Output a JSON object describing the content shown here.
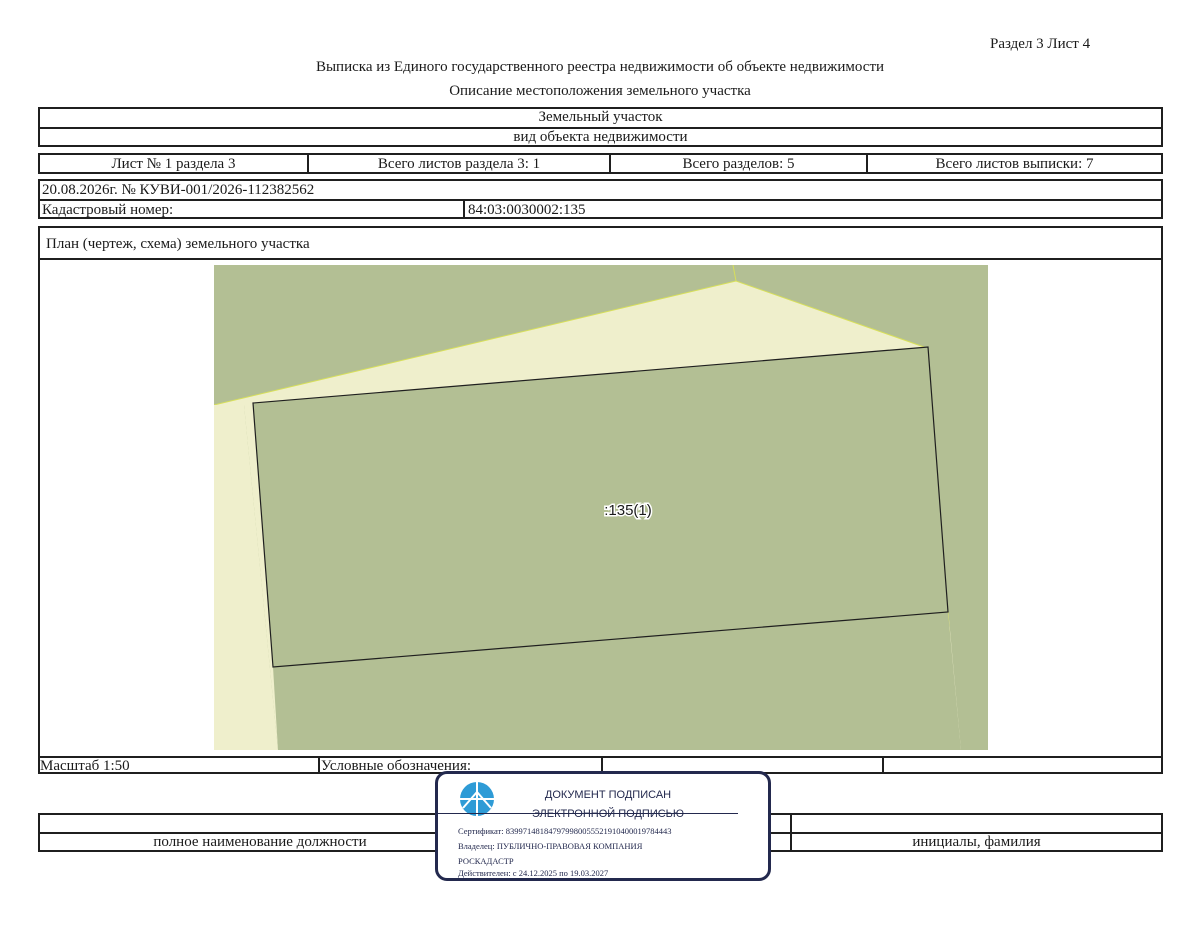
{
  "header": {
    "section_sheet": "Раздел 3    Лист 4",
    "title": "Выписка из Единого государственного реестра недвижимости об объекте недвижимости",
    "subtitle": "Описание местоположения земельного участка"
  },
  "object": {
    "name": "Земельный участок",
    "kind_label": "вид объекта недвижимости"
  },
  "sheets_row": {
    "sheet": "Лист № 1 раздела 3",
    "total_section_sheets": "Всего листов раздела 3: 1",
    "total_sections": "Всего разделов: 5",
    "total_extract_sheets": "Всего листов выписки: 7"
  },
  "request": {
    "date_number": "20.08.2026г. № КУВИ-001/2026-112382562",
    "cadastral_label": "Кадастровый номер:",
    "cadastral_value": "84:03:0030002:135"
  },
  "plan": {
    "title": "План (чертеж, схема) земельного участка",
    "parcel_label": ":135(1)",
    "colors": {
      "background": "#b3bf94",
      "road": "#efefcc",
      "outline": "#1f1f1f",
      "road_edge": "#d8e05a"
    }
  },
  "footer": {
    "scale": "Масштаб 1:50",
    "legend_label": "Условные обозначения:",
    "position_label": "полное наименование должности",
    "initials_label": "инициалы, фамилия"
  },
  "stamp": {
    "line1": "ДОКУМЕНТ ПОДПИСАН",
    "line2": "ЭЛЕКТРОННОЙ ПОДПИСЬЮ",
    "certificate": "Сертификат: 839971481847979980055521910400019784443",
    "owner": "Владелец: ПУБЛИЧНО-ПРАВОВАЯ КОМПАНИЯ",
    "owner2": "РОСКАДАСТР",
    "valid": "Действителен: с 24.12.2025 по 19.03.2027",
    "icon": "roskadastr-logo-icon",
    "color": "#23294e"
  }
}
